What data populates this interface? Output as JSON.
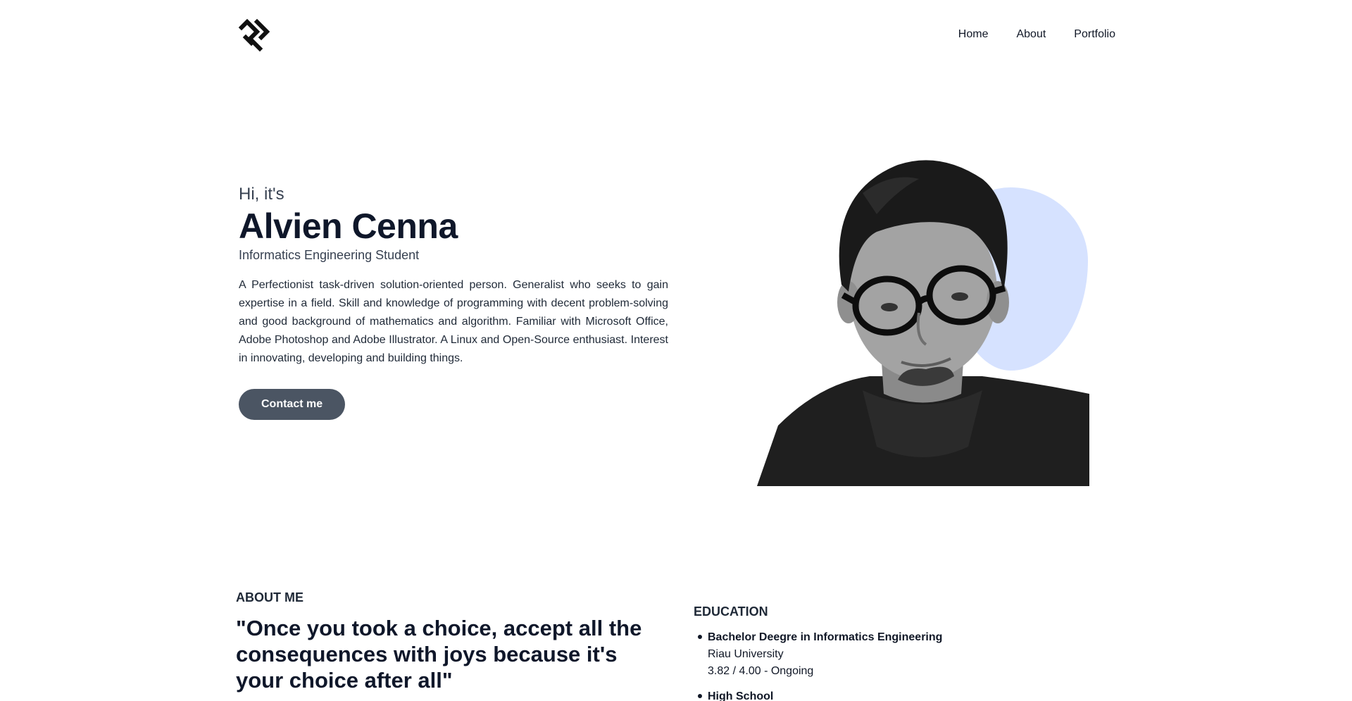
{
  "header": {
    "logo_icon": "lc-monogram-logo-icon",
    "nav": [
      {
        "label": "Home"
      },
      {
        "label": "About"
      },
      {
        "label": "Portfolio"
      }
    ]
  },
  "hero": {
    "greeting": "Hi, it's",
    "name": "Alvien Cenna",
    "subtitle": "Informatics Engineering Student",
    "bio": "A Perfectionist task-driven solution-oriented person. Generalist who seeks to gain expertise in a field. Skill and knowledge of programming with decent problem-solving and good background of mathematics and algorithm. Familiar with Microsoft Office, Adobe Photoshop and Adobe Illustrator. A Linux and Open-Source enthusiast. Interest in innovating, developing and building things.",
    "contact_button": "Contact me",
    "accent_blob_color": "#d6e2ff",
    "button_color": "#4b5563"
  },
  "about": {
    "label": "ABOUT ME",
    "quote": "\"Once you took a choice, accept all the consequences with joys because it's your choice after all\""
  },
  "education": {
    "label": "EDUCATION",
    "items": [
      {
        "degree": "Bachelor Deegre in Informatics Engineering",
        "school": "Riau University",
        "grade": "3.82 / 4.00 - Ongoing"
      },
      {
        "degree": "High School",
        "school": "",
        "grade": ""
      }
    ]
  }
}
